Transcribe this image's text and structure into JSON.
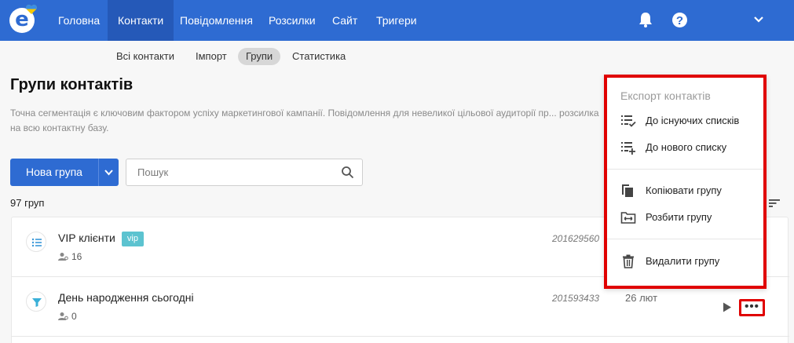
{
  "nav": {
    "items": [
      {
        "label": "Головна"
      },
      {
        "label": "Контакти"
      },
      {
        "label": "Повідомлення"
      },
      {
        "label": "Розсилки"
      },
      {
        "label": "Сайт"
      },
      {
        "label": "Тригери"
      }
    ],
    "active": "Контакти",
    "help_glyph": "?"
  },
  "subnav": {
    "items": [
      {
        "label": "Всі контакти"
      },
      {
        "label": "Імпорт"
      },
      {
        "label": "Групи"
      },
      {
        "label": "Статистика"
      }
    ],
    "active": "Групи"
  },
  "page": {
    "title": "Групи контактів",
    "description": "Точна сегментація є ключовим фактором успіху маркетингової кампанії. Повідомлення для невеликої цільової аудиторії пр... розсилка на всю контактну базу."
  },
  "toolbar": {
    "new_group_label": "Нова група",
    "search_placeholder": "Пошук"
  },
  "groups": {
    "count_label": "97 груп",
    "rows": [
      {
        "name": "VIP клієнти",
        "badge": "vip",
        "members": "16",
        "id": "201629560",
        "date": "",
        "icon": "list-icon"
      },
      {
        "name": "День народження сьогодні",
        "badge": "",
        "members": "0",
        "id": "201593433",
        "date": "26 лют",
        "icon": "filter-icon"
      }
    ]
  },
  "context_menu": {
    "header": "Експорт контактів",
    "items": [
      {
        "label": "До існуючих списків",
        "icon": "list-check-icon"
      },
      {
        "label": "До нового списку",
        "icon": "list-add-icon"
      },
      {
        "label": "Копіювати групу",
        "icon": "copy-icon"
      },
      {
        "label": "Розбити групу",
        "icon": "split-icon"
      },
      {
        "label": "Видалити групу",
        "icon": "trash-icon"
      }
    ]
  },
  "colors": {
    "brand": "#2e6bd2",
    "highlight": "#e00000",
    "badge": "#5cc3d0"
  }
}
